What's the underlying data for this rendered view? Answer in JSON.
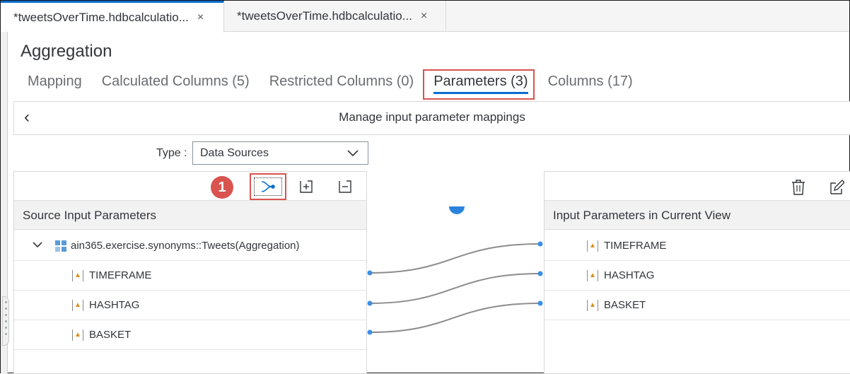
{
  "editor_tabs": [
    {
      "label": "*tweetsOverTime.hdbcalculatio...",
      "close": "×"
    },
    {
      "label": "*tweetsOverTime.hdbcalculatio...",
      "close": "×"
    }
  ],
  "title": "Aggregation",
  "sub_tabs": [
    {
      "label": "Mapping"
    },
    {
      "label": "Calculated Columns (5)"
    },
    {
      "label": "Restricted Columns (0)"
    },
    {
      "label": "Parameters (3)"
    },
    {
      "label": "Columns (17)"
    }
  ],
  "selected_sub_tab": "Parameters (3)",
  "manage_header": {
    "back": "‹",
    "title": "Manage input parameter mappings"
  },
  "type_filter": {
    "label": "Type :",
    "value": "Data Sources"
  },
  "callout": {
    "number": "1"
  },
  "source_panel": {
    "header": "Source Input Parameters",
    "node": "ain365.exercise.synonyms::Tweets(Aggregation)",
    "items": [
      "TIMEFRAME",
      "HASHTAG",
      "BASKET"
    ]
  },
  "target_panel": {
    "header": "Input Parameters in Current View",
    "items": [
      "TIMEFRAME",
      "HASHTAG",
      "BASKET"
    ]
  },
  "mappings": [
    {
      "from": "TIMEFRAME",
      "to": "TIMEFRAME"
    },
    {
      "from": "HASHTAG",
      "to": "HASHTAG"
    },
    {
      "from": "BASKET",
      "to": "BASKET"
    }
  ],
  "colors": {
    "accent": "#0a6ed1",
    "highlight": "#d9534f",
    "line": "#8c8c8c",
    "dot": "#3a8ee6"
  }
}
